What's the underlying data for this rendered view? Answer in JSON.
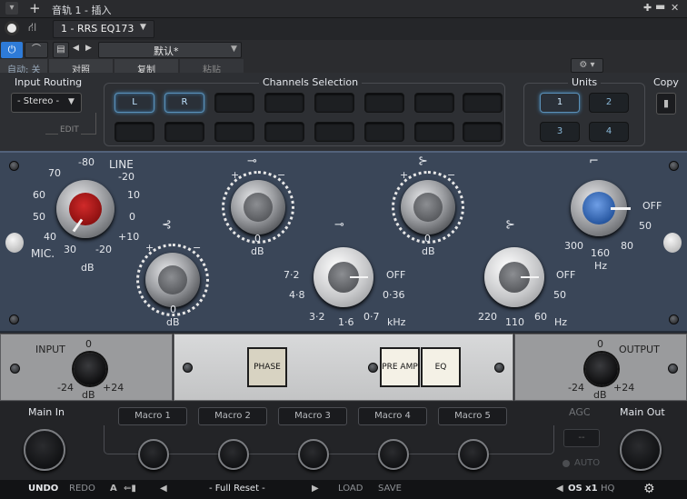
{
  "window": {
    "title": "音轨 1 - 插入"
  },
  "toolbar": {
    "plugin_name": "1 - RRS EQ173",
    "preset": "默认*",
    "auto_label": "自动: 关",
    "compare_label": "对照",
    "copy_label": "复制",
    "paste_label": "粘贴"
  },
  "top": {
    "input_routing_label": "Input Routing",
    "routing_value": "- Stereo -",
    "edit_label": "EDIT",
    "channels_label": "Channels Selection",
    "channel_l": "L",
    "channel_r": "R",
    "units_label": "Units",
    "unit_1": "1",
    "unit_2": "2",
    "unit_3": "3",
    "unit_4": "4",
    "copy_label": "Copy"
  },
  "eq": {
    "line_label": "LINE",
    "mic_label": "MIC.",
    "db": "dB",
    "hz": "Hz",
    "khz": "kHz",
    "off": "OFF",
    "gain_scale": [
      "-80",
      "-20",
      "10",
      "0",
      "+10",
      "-20",
      "30",
      "40",
      "50",
      "60",
      "70"
    ],
    "zero": "0",
    "plus": "+",
    "minus": "−",
    "mid_freqs": [
      "7·2",
      "OFF",
      "4·8",
      "0·36",
      "3·2",
      "1·6",
      "0·7"
    ],
    "hi_freqs": [
      "OFF",
      "50",
      "110",
      "60",
      "220"
    ],
    "hpf_freqs": [
      "OFF",
      "50",
      "80",
      "160",
      "300"
    ]
  },
  "io": {
    "input_label": "INPUT",
    "output_label": "OUTPUT",
    "zero": "0",
    "min": "-24",
    "max": "+24",
    "db": "dB",
    "phase_label": "PHASE",
    "preamp_label": "PRE AMP",
    "eq_label": "EQ"
  },
  "macros": {
    "main_in": "Main In",
    "main_out": "Main Out",
    "agc": "AGC",
    "agc_value": "--",
    "auto": "AUTO",
    "items": [
      "Macro 1",
      "Macro 2",
      "Macro 3",
      "Macro 4",
      "Macro 5"
    ]
  },
  "bottom": {
    "undo": "UNDO",
    "redo": "REDO",
    "a": "A",
    "preset": "- Full Reset -",
    "load": "LOAD",
    "save": "SAVE",
    "os": "OS x1",
    "hq": "HQ"
  }
}
